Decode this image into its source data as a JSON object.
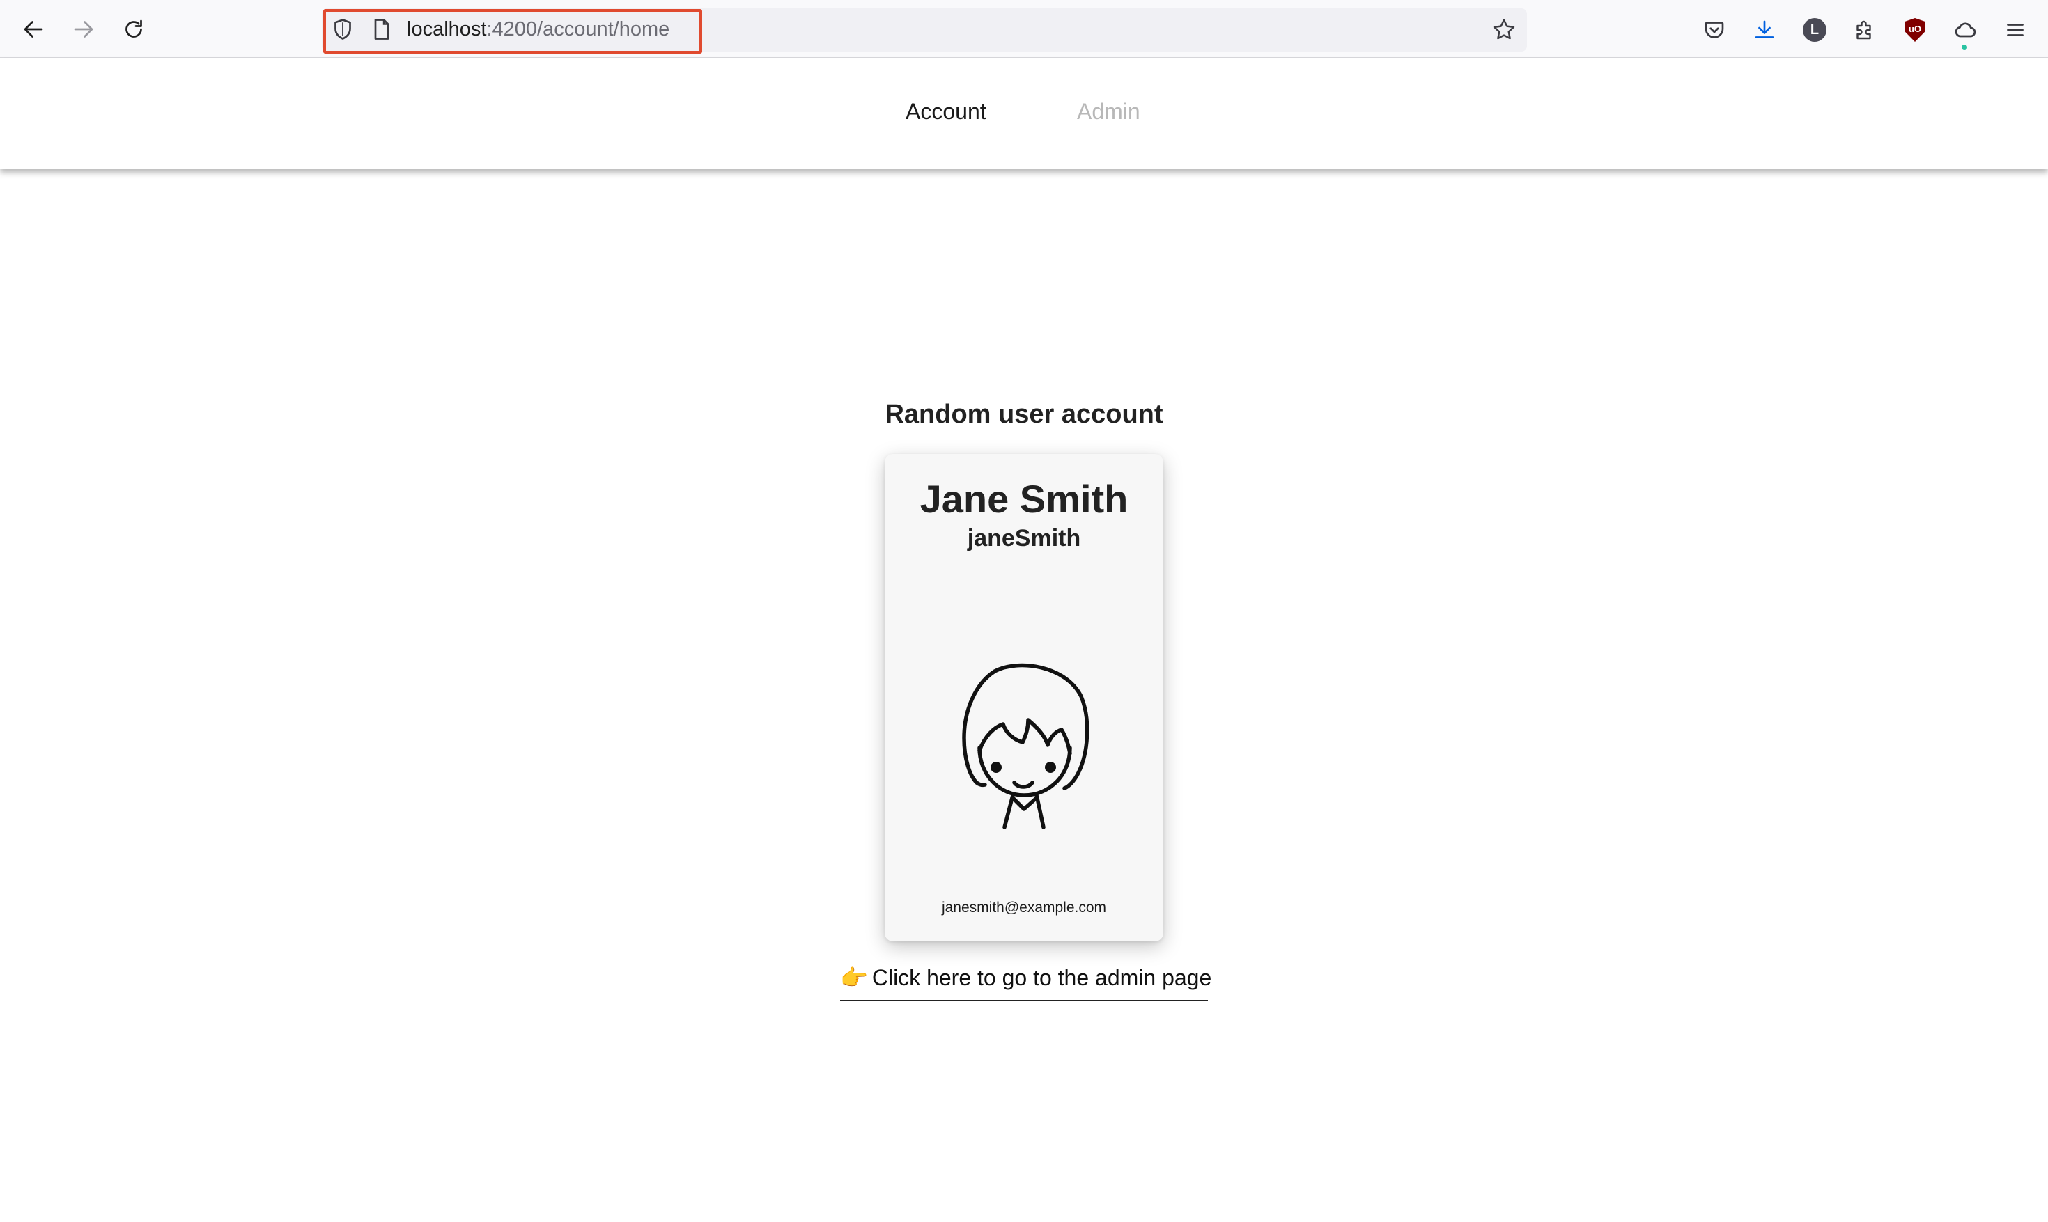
{
  "browser": {
    "url_host": "localhost",
    "url_path": ":4200/account/home",
    "icons": {
      "back": "arrow-left-icon",
      "forward": "arrow-right-icon",
      "reload": "reload-icon",
      "shield": "shield-icon",
      "page": "page-icon",
      "bookmark": "star-icon",
      "pocket": "pocket-icon",
      "downloads": "download-icon",
      "account": "account-icon",
      "extensions": "puzzle-icon",
      "ublock": "ublock-icon",
      "sync": "cloud-icon",
      "menu": "hamburger-icon"
    },
    "account_initial": "L",
    "ublock_text": "uO",
    "highlight_color": "#e04a2f"
  },
  "appnav": {
    "items": [
      {
        "label": "Account",
        "active": true
      },
      {
        "label": "Admin",
        "active": false
      }
    ]
  },
  "main": {
    "title": "Random user account",
    "card": {
      "name": "Jane Smith",
      "username": "janeSmith",
      "avatar_icon": "girl-avatar-icon",
      "email": "janesmith@example.com"
    },
    "admin_link": {
      "emoji": "👉",
      "label": "Click here to go to the admin page"
    }
  }
}
